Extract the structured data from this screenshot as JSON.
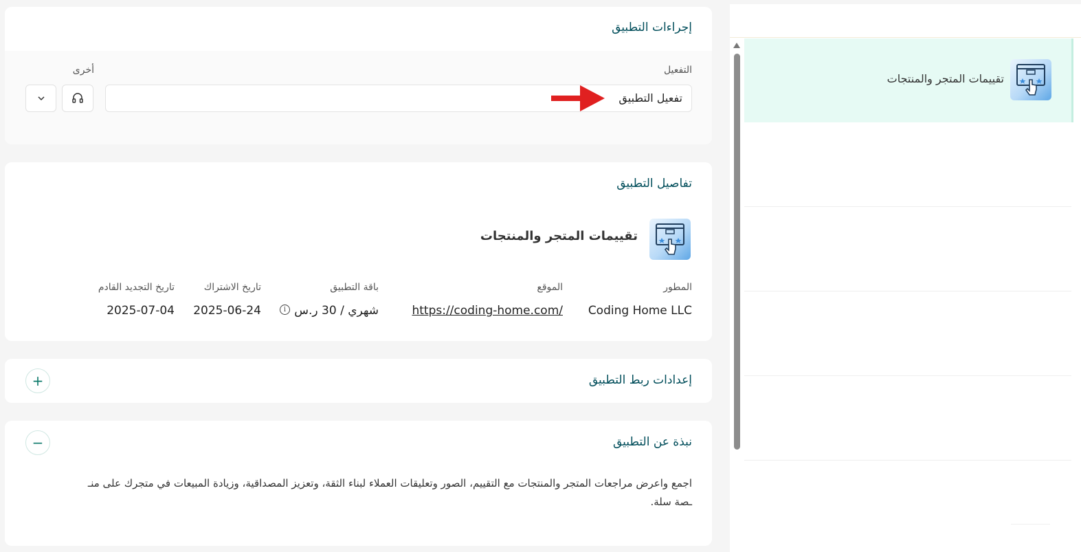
{
  "sidebar": {
    "active_app_name": "تقييمات المتجر والمنتجات"
  },
  "actions_card": {
    "title": "إجراءات التطبيق",
    "activation_label": "التفعيل",
    "activation_value": "تفعيل التطبيق",
    "other_label": "أخرى",
    "support_icon": "headset-icon",
    "dropdown_icon": "chevron-down-icon"
  },
  "details_card": {
    "title": "تفاصيل التطبيق",
    "app_name": "تقييمات المتجر والمنتجات",
    "fields": {
      "developer_label": "المطور",
      "developer_value": "Coding Home LLC",
      "website_label": "الموقع",
      "website_value": "https://coding-home.com/",
      "plan_label": "باقة التطبيق",
      "plan_value": "شهري / 30 ر.س",
      "subscription_label": "تاريخ الاشتراك",
      "subscription_value": "2025-06-24",
      "renewal_label": "تاريخ التجديد القادم",
      "renewal_value": "2025-07-04"
    }
  },
  "linking_card": {
    "title": "إعدادات ربط التطبيق",
    "toggle_symbol": "+"
  },
  "about_card": {
    "title": "نبذة عن التطبيق",
    "toggle_symbol": "−",
    "line1": "اجمع واعرض مراجعات المتجر والمنتجات مع التقييم، الصور وتعليقات العملاء لبناء الثقة، وتعزيز المصداقية، وزيادة المبيعات في متجرك على منـ",
    "line2": "ـصة سلة."
  },
  "colors": {
    "accent": "#004d5a",
    "active_bg": "#e6faf4",
    "arrow": "#e02020"
  }
}
